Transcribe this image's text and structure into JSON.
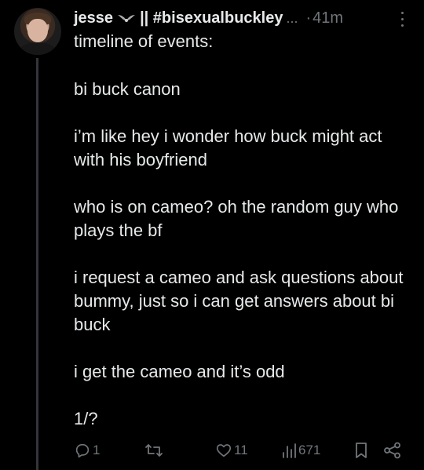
{
  "tweet": {
    "display_name": "jesse",
    "badge_icon": "bird-wings-icon",
    "name_suffix": "|| #bisexualbuckley",
    "truncation": "...",
    "separator": "·",
    "timestamp": "41m",
    "paragraphs": [
      "timeline of events:",
      "bi buck canon",
      "i’m like hey i wonder how buck might act with his boyfriend",
      "who is on cameo? oh the random guy who plays the bf",
      "i request a cameo and ask questions about bummy, just so i can get answers about bi buck",
      "i get the cameo and it’s odd",
      "1/?"
    ]
  },
  "actions": {
    "reply_count": "1",
    "retweet_count": "",
    "like_count": "11",
    "view_count": "671"
  },
  "colors": {
    "background": "#000000",
    "text": "#e7e9ea",
    "muted": "#71767b",
    "thread_line": "#333639"
  }
}
